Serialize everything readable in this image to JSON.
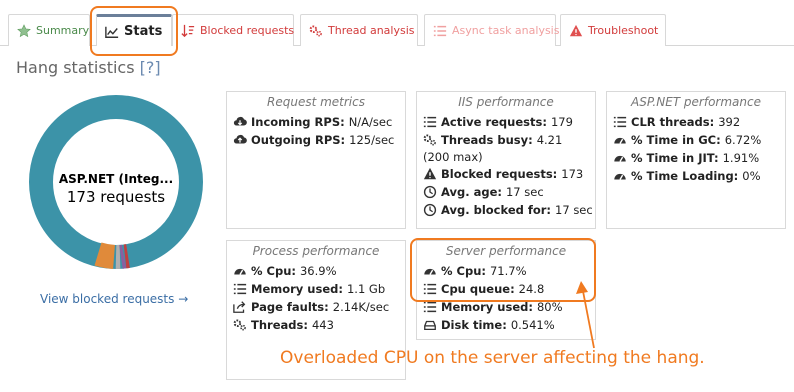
{
  "tabs": [
    {
      "label": "Summary",
      "icon": "star-icon"
    },
    {
      "label": "Stats",
      "icon": "chart-icon"
    },
    {
      "label": "Blocked requests",
      "icon": "sort-icon"
    },
    {
      "label": "Thread analysis",
      "icon": "gears-icon"
    },
    {
      "label": "Async task analysis",
      "icon": "list-icon"
    },
    {
      "label": "Troubleshoot",
      "icon": "warning-icon"
    }
  ],
  "title": "Hang statistics",
  "help": "[?]",
  "donut": {
    "line1": "ASP.NET (Integ...",
    "line2": "173 requests",
    "main_color": "#3c93a8",
    "accent_colors": [
      "#e08a3a",
      "#b0b0b0",
      "#8a5fa0",
      "#c04040"
    ]
  },
  "view_link": "View blocked requests →",
  "panels": {
    "request": {
      "title": "Request metrics",
      "rows": [
        {
          "key": "Incoming RPS:",
          "value": "N/A/sec",
          "icon": "cloud-download-icon"
        },
        {
          "key": "Outgoing RPS:",
          "value": "125/sec",
          "icon": "cloud-upload-icon"
        }
      ]
    },
    "iis": {
      "title": "IIS performance",
      "rows": [
        {
          "key": "Active requests:",
          "value": "179",
          "icon": "list-icon"
        },
        {
          "key": "Threads busy:",
          "value": "4.21",
          "icon": "gears-icon",
          "cont": "(200 max)"
        },
        {
          "key": "Blocked requests:",
          "value": "173",
          "icon": "warning-icon"
        },
        {
          "key": "Avg. age:",
          "value": "17 sec",
          "icon": "clock-icon"
        },
        {
          "key": "Avg. blocked for:",
          "value": "17 sec",
          "icon": "clock-icon"
        }
      ]
    },
    "aspnet": {
      "title": "ASP.NET performance",
      "rows": [
        {
          "key": "CLR threads:",
          "value": "392",
          "icon": "list-icon"
        },
        {
          "key": "% Time in GC:",
          "value": "6.72%",
          "icon": "gauge-icon"
        },
        {
          "key": "% Time in JIT:",
          "value": "1.91%",
          "icon": "gauge-icon"
        },
        {
          "key": "% Time Loading:",
          "value": "0%",
          "icon": "gauge-icon"
        }
      ]
    },
    "process": {
      "title": "Process performance",
      "rows": [
        {
          "key": "% Cpu:",
          "value": "36.9%",
          "icon": "gauge-icon"
        },
        {
          "key": "Memory used:",
          "value": "1.1 Gb",
          "icon": "list-icon"
        },
        {
          "key": "Page faults:",
          "value": "2.14K/sec",
          "icon": "share-icon"
        },
        {
          "key": "Threads:",
          "value": "443",
          "icon": "gears-icon"
        }
      ]
    },
    "server": {
      "title": "Server performance",
      "rows": [
        {
          "key": "% Cpu:",
          "value": "71.7%",
          "icon": "gauge-icon"
        },
        {
          "key": "Cpu queue:",
          "value": "24.8",
          "icon": "list-icon"
        },
        {
          "key": "Memory used:",
          "value": "80%",
          "icon": "list-icon"
        },
        {
          "key": "Disk time:",
          "value": "0.541%",
          "icon": "disk-icon"
        }
      ]
    }
  },
  "annotation": "Overloaded CPU on the server affecting the hang.",
  "accent": "#f07a20"
}
